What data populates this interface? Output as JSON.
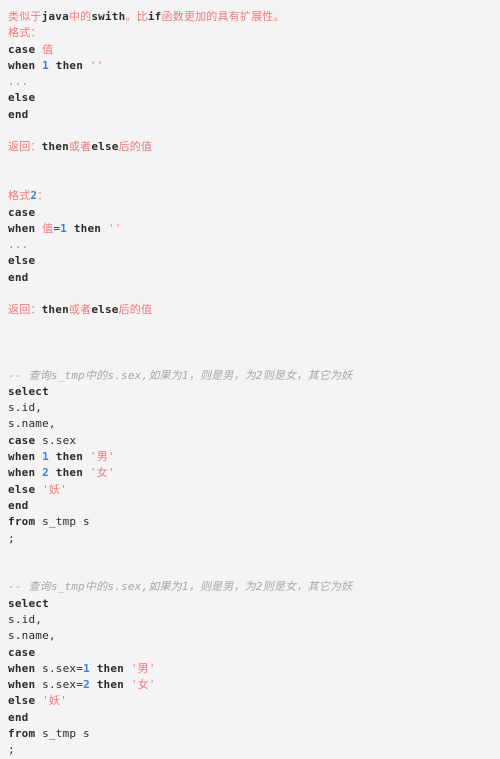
{
  "page": {
    "background_color": "#f4f4f4",
    "kind": "code-snippet-viewer",
    "language": "sql"
  },
  "colors": {
    "keyword": "#2b2b2b",
    "number": "#3a7fe0",
    "string": "#ef7b7b",
    "chinese_note": "#f07a7a",
    "comment": "#a6a6a6",
    "ellipsis": "#8a8a8a",
    "background": "#f4f4f4"
  },
  "content": {
    "intro": {
      "cn_1": "类似于",
      "kw_java": "java",
      "cn_2": "中的",
      "kw_swith": "swith",
      "cn_3": "。比",
      "kw_if": "if",
      "cn_4": "函数更加的具有扩展性。"
    },
    "format_1_label": "格式：",
    "format_1": {
      "l1_kw": "case",
      "l1_val": "值",
      "l2_when": "when",
      "l2_num": "1",
      "l2_then": "then",
      "l2_str": "''",
      "l3_dots": "...",
      "l4_else": "else",
      "l5_end": "end"
    },
    "return_1": {
      "cn_a": "返回：",
      "kw_then": "then",
      "cn_b": "或者",
      "kw_else": "else",
      "cn_c": "后的值"
    },
    "format_2_label": {
      "cn_a": "格式",
      "num": "2",
      "cn_b": "："
    },
    "format_2": {
      "l1_kw": "case",
      "l2_when": "when",
      "l2_val": "值",
      "l2_eq": "=",
      "l2_num": "1",
      "l2_then": "then",
      "l2_str": "''",
      "l3_dots": "...",
      "l4_else": "else",
      "l5_end": "end"
    },
    "return_2": {
      "cn_a": "返回：",
      "kw_then": "then",
      "cn_b": "或者",
      "kw_else": "else",
      "cn_c": "后的值"
    },
    "query_1": {
      "comment": "-- 查询s_tmp中的s.sex,如果为1，则是男，为2则是女，其它为妖",
      "select": "select",
      "col_id": "s.id,",
      "col_name": "s.name,",
      "case_kw": "case",
      "case_expr": "s.sex",
      "when_kw": "when",
      "when1_num": "1",
      "then_kw": "then",
      "then1_str": "'男'",
      "when2_num": "2",
      "then2_str": "'女'",
      "else_kw": "else",
      "else_str": "'妖'",
      "end_kw": "end",
      "from_kw": "from",
      "from_table": "s_tmp s",
      "terminator": ";"
    },
    "query_2": {
      "comment": "-- 查询s_tmp中的s.sex,如果为1，则是男，为2则是女，其它为妖",
      "select": "select",
      "col_id": "s.id,",
      "col_name": "s.name,",
      "case_kw": "case",
      "when_kw": "when",
      "when1_expr": "s.sex=",
      "when1_num": "1",
      "then_kw": "then",
      "then1_str": "'男'",
      "when2_expr": "s.sex=",
      "when2_num": "2",
      "then2_str": "'女'",
      "else_kw": "else",
      "else_str": "'妖'",
      "end_kw": "end",
      "from_kw": "from",
      "from_table": "s_tmp s",
      "terminator": ";"
    }
  }
}
